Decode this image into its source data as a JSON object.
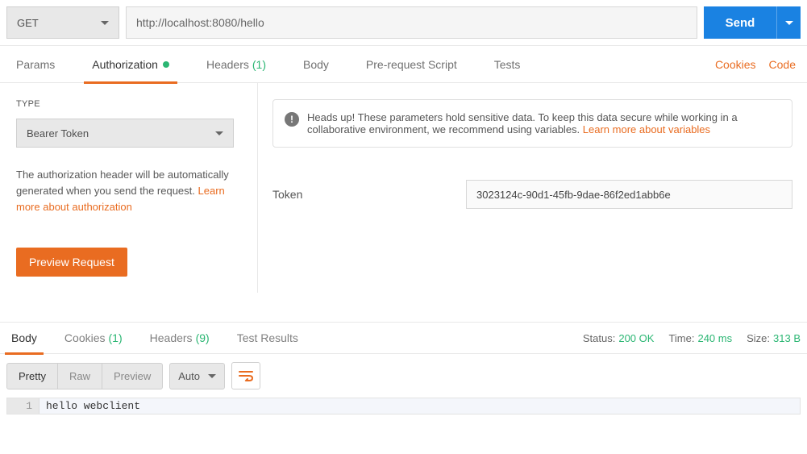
{
  "request": {
    "method": "GET",
    "url": "http://localhost:8080/hello",
    "send_label": "Send"
  },
  "tabs": {
    "params": "Params",
    "authorization": "Authorization",
    "headers": "Headers",
    "headers_count": "(1)",
    "body": "Body",
    "prerequest": "Pre-request Script",
    "tests": "Tests",
    "cookies_link": "Cookies",
    "code_link": "Code"
  },
  "auth": {
    "type_label": "TYPE",
    "type_value": "Bearer Token",
    "help_text": "The authorization header will be automatically generated when you send the request. ",
    "help_link": "Learn more about authorization",
    "preview_label": "Preview Request",
    "banner_text": "Heads up! These parameters hold sensitive data. To keep this data secure while working in a collaborative environment, we recommend using variables. ",
    "banner_link": "Learn more about variables",
    "token_label": "Token",
    "token_value": "3023124c-90d1-45fb-9dae-86f2ed1abb6e"
  },
  "response": {
    "tabs": {
      "body": "Body",
      "cookies": "Cookies",
      "cookies_count": "(1)",
      "headers": "Headers",
      "headers_count": "(9)",
      "test_results": "Test Results"
    },
    "status_label": "Status:",
    "status_value": "200 OK",
    "time_label": "Time:",
    "time_value": "240 ms",
    "size_label": "Size:",
    "size_value": "313 B",
    "view": {
      "pretty": "Pretty",
      "raw": "Raw",
      "preview": "Preview",
      "auto": "Auto"
    },
    "line_number": "1",
    "body_text": "hello webclient"
  }
}
